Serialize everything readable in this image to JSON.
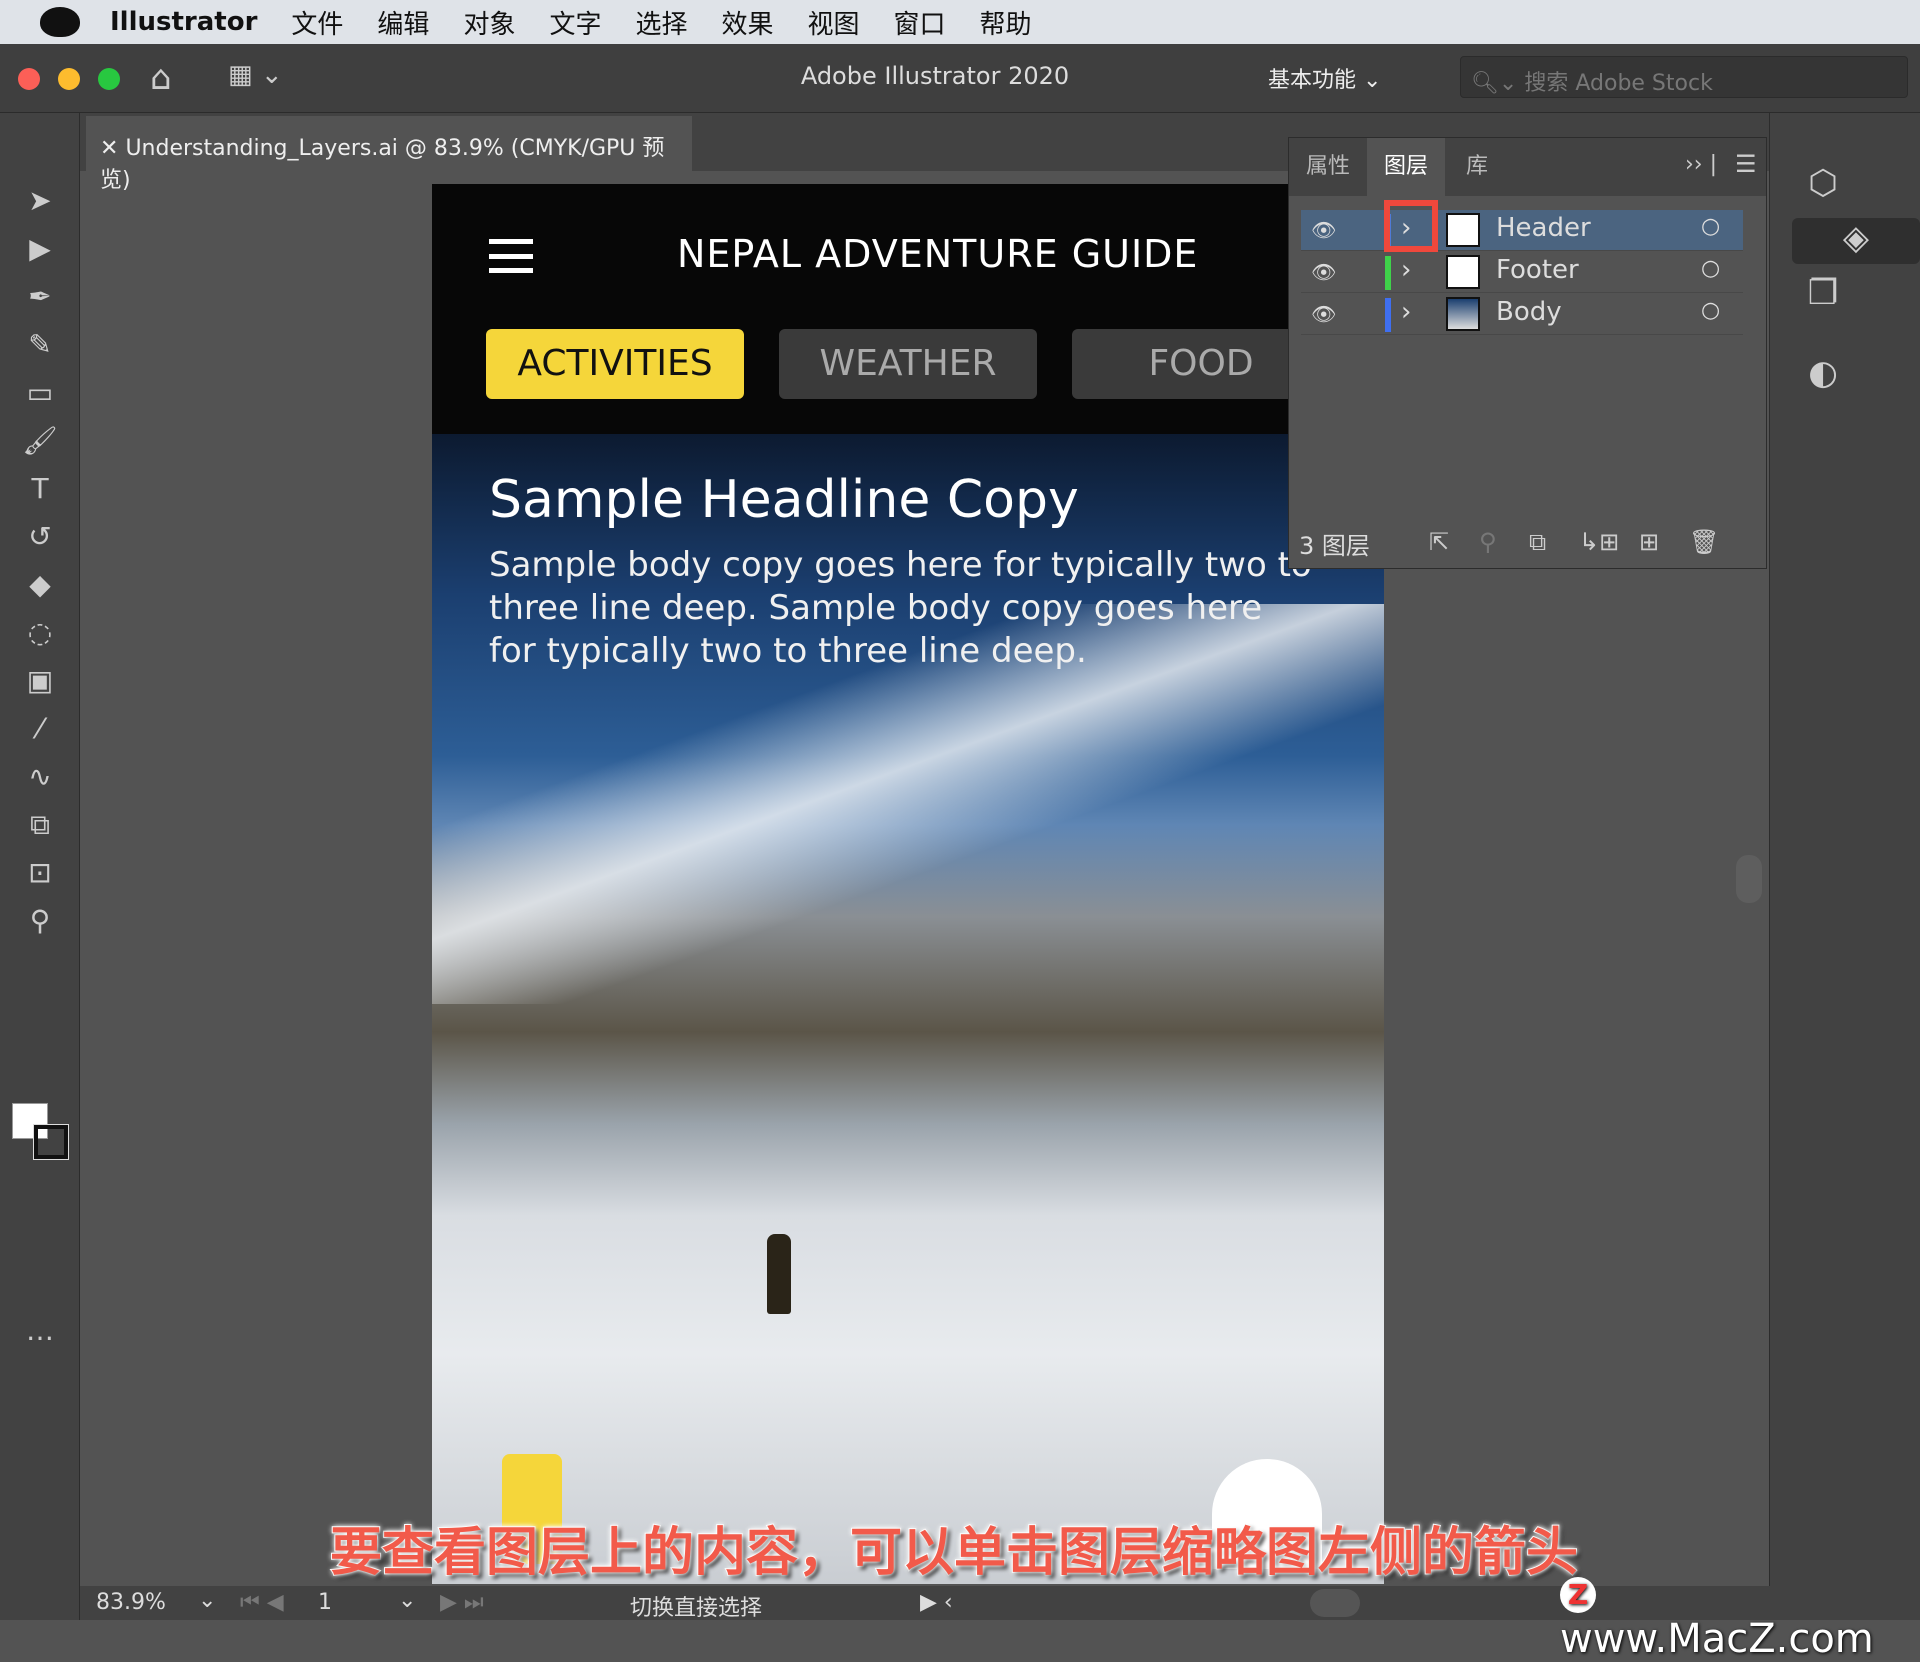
{
  "menubar": {
    "app": "Illustrator",
    "items": [
      "文件",
      "编辑",
      "对象",
      "文字",
      "选择",
      "效果",
      "视图",
      "窗口",
      "帮助"
    ]
  },
  "titlebar": {
    "title": "Adobe Illustrator 2020",
    "workspace": "基本功能",
    "search_placeholder": "搜索 Adobe Stock"
  },
  "document": {
    "tab": "Understanding_Layers.ai @ 83.9% (CMYK/GPU 预览)"
  },
  "artboard": {
    "title": "NEPAL ADVENTURE GUIDE",
    "nav": [
      "ACTIVITIES",
      "WEATHER",
      "FOOD"
    ],
    "headline": "Sample Headline Copy",
    "body": "Sample body copy goes here for typically two to three line deep. Sample body copy goes here for typically two to three line deep.",
    "accent": "#f5d63a"
  },
  "layers_panel": {
    "tabs": [
      "属性",
      "图层",
      "库"
    ],
    "active_tab": "图层",
    "layers": [
      {
        "name": "Header",
        "color": "#4f7bd8",
        "selected": true
      },
      {
        "name": "Footer",
        "color": "#3fd24a",
        "selected": false
      },
      {
        "name": "Body",
        "color": "#3f6ff0",
        "selected": false
      }
    ],
    "count_label": "3 图层"
  },
  "status": {
    "zoom": "83.9%",
    "artboard": "1",
    "tool_hint": "切换直接选择"
  },
  "subtitle": "要查看图层上的内容，可以单击图层缩略图左侧的箭头",
  "watermark": "www.MacZ.com"
}
